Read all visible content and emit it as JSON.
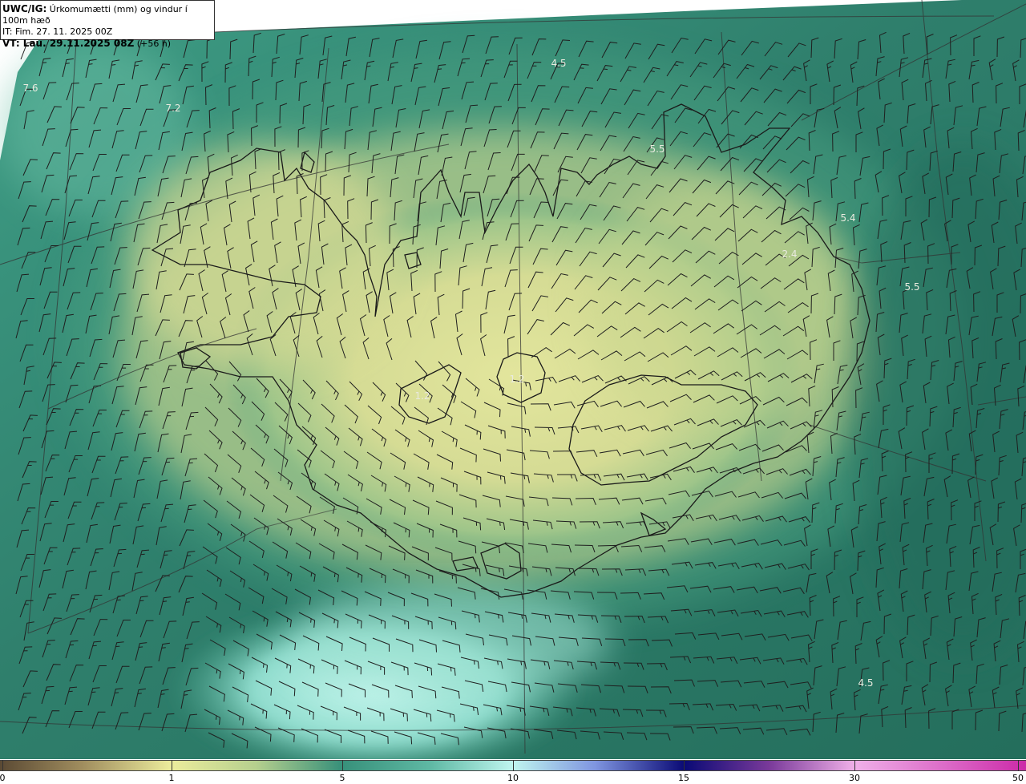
{
  "header": {
    "title_prefix": "UWC/IG:",
    "title_rest": " Úrkomumætti (mm) og vindur í 100m hæð",
    "it_line": "IT: Fim. 27. 11. 2025 00Z",
    "vt_prefix": "VT: Lau. 29.11.2025 08Z",
    "vt_rest": " (+56 h)"
  },
  "map_labels": [
    "7.6",
    "7.2",
    "4.5",
    "5.5",
    "5.4",
    "2.4",
    "5.5",
    "1.2",
    "1.2",
    "4.5"
  ],
  "colorbar": {
    "ticks": [
      "0",
      "1",
      "5",
      "10",
      "15",
      "30",
      "50"
    ],
    "colors": {
      "c0": "#5b4a34",
      "c1": "#ecec9c",
      "c5": "#37907a",
      "c10": "#bff5ef",
      "c15": "#0a0a75",
      "c30": "#f0b0e8",
      "c50": "#cc2aa8"
    }
  },
  "map_colors": {
    "land_yellow": "#e3e49a",
    "coast_green": "#4aa482",
    "sea_teal": "#30806c",
    "sea_dark": "#226a5a",
    "sea_light": "#aef0e4",
    "coastline": "#1a1a1a",
    "wind_barb": "#1f1f1f"
  }
}
